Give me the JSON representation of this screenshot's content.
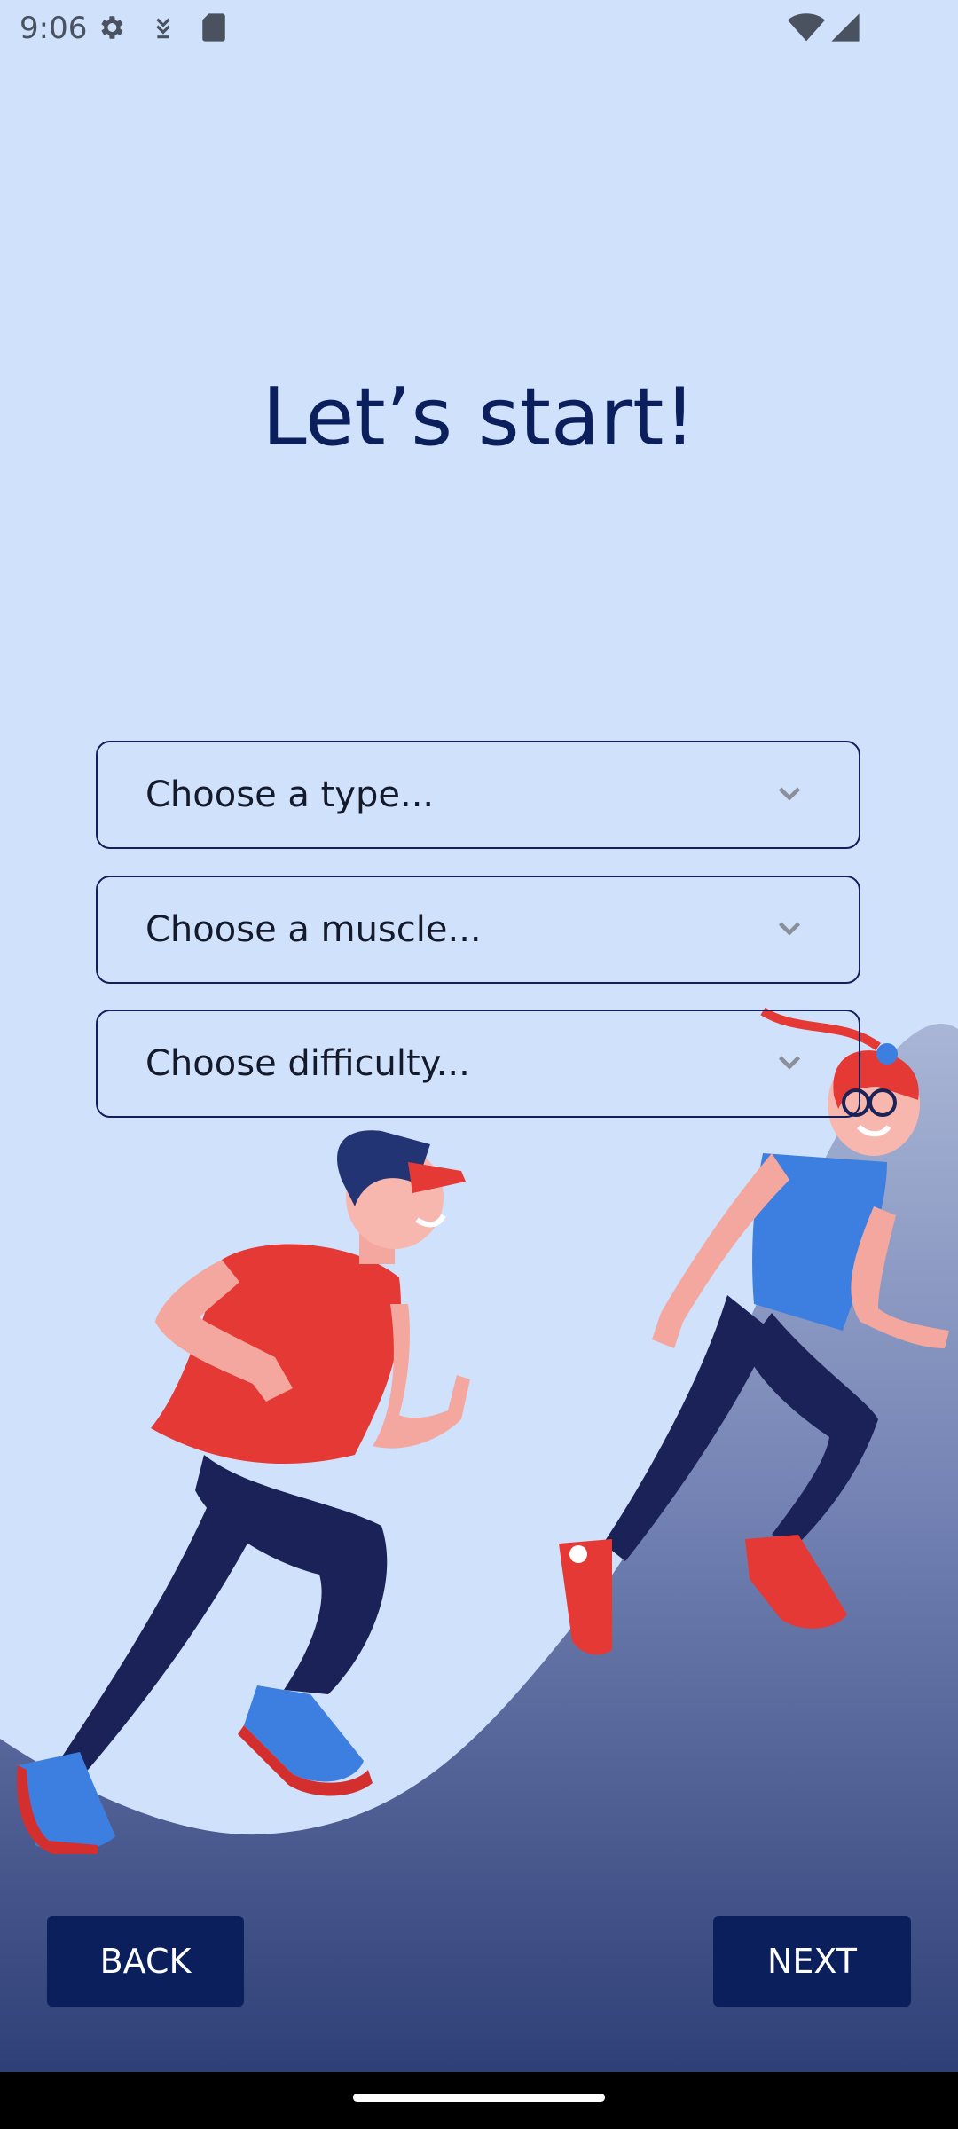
{
  "status_bar": {
    "time": "9:06",
    "icons": [
      "gear-icon",
      "download-icon",
      "sd-card-icon",
      "wifi-icon",
      "signal-icon"
    ]
  },
  "main": {
    "title": "Let’s start!",
    "dropdowns": [
      {
        "placeholder": "Choose a type..."
      },
      {
        "placeholder": "Choose a muscle..."
      },
      {
        "placeholder": "Choose difficulty..."
      }
    ]
  },
  "buttons": {
    "back_label": "BACK",
    "next_label": "NEXT"
  },
  "colors": {
    "background": "#cfe1fb",
    "accent": "#0b1f5c",
    "wave_top": "#8493bd",
    "wave_bottom": "#2e3f77",
    "runner_shirt": "#e53935",
    "runner_pants": "#1b2258"
  }
}
